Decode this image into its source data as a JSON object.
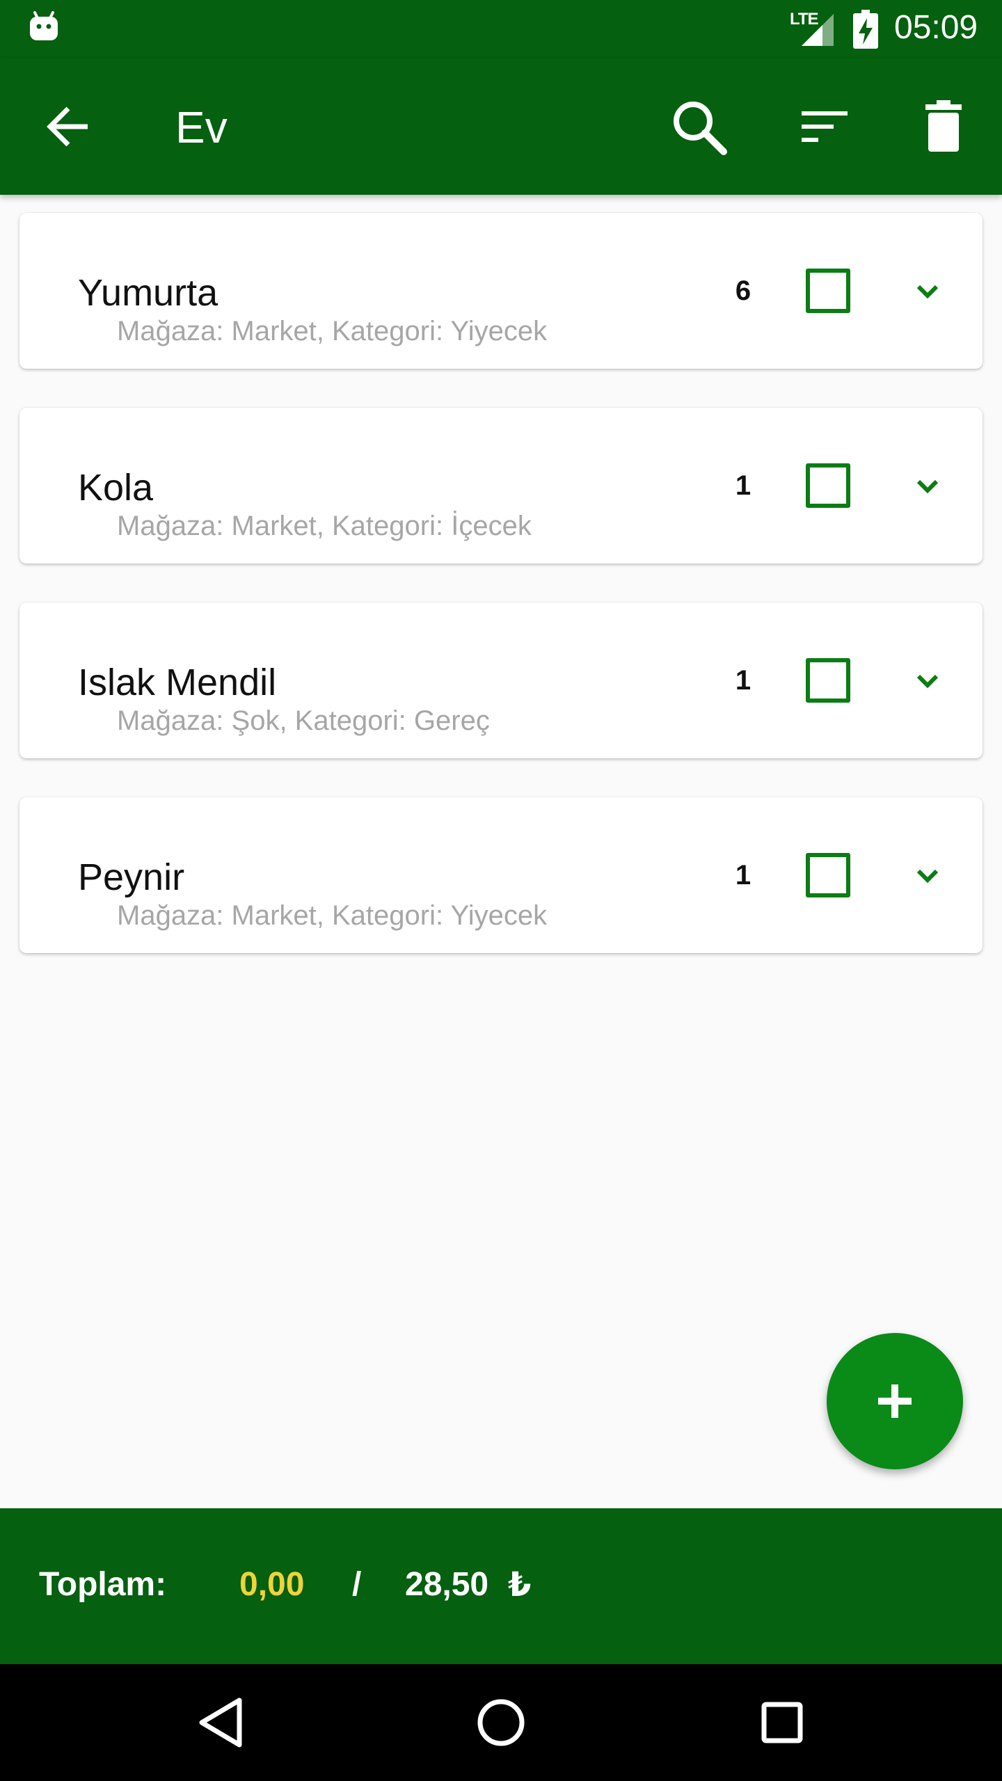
{
  "status_bar": {
    "network_label": "LTE",
    "time": "05:09"
  },
  "toolbar": {
    "title": "Ev",
    "icons": [
      "back-arrow-icon",
      "search-icon",
      "sort-icon",
      "delete-icon"
    ]
  },
  "items": [
    {
      "name": "Yumurta",
      "meta": "Mağaza: Market, Kategori: Yiyecek",
      "quantity": "6",
      "checked": false
    },
    {
      "name": "Kola",
      "meta": "Mağaza: Market, Kategori: İçecek",
      "quantity": "1",
      "checked": false
    },
    {
      "name": "Islak Mendil",
      "meta": "Mağaza: Şok, Kategori: Gereç",
      "quantity": "1",
      "checked": false
    },
    {
      "name": "Peynir",
      "meta": "Mağaza: Market, Kategori: Yiyecek",
      "quantity": "1",
      "checked": false
    }
  ],
  "total_bar": {
    "label": "Toplam:",
    "checked_total": "0,00",
    "separator": "/",
    "total": "28,50",
    "currency": "₺"
  },
  "colors": {
    "primary_dark": "#05600f",
    "accent": "#0a8a17",
    "checked_total": "#f0d33a"
  }
}
